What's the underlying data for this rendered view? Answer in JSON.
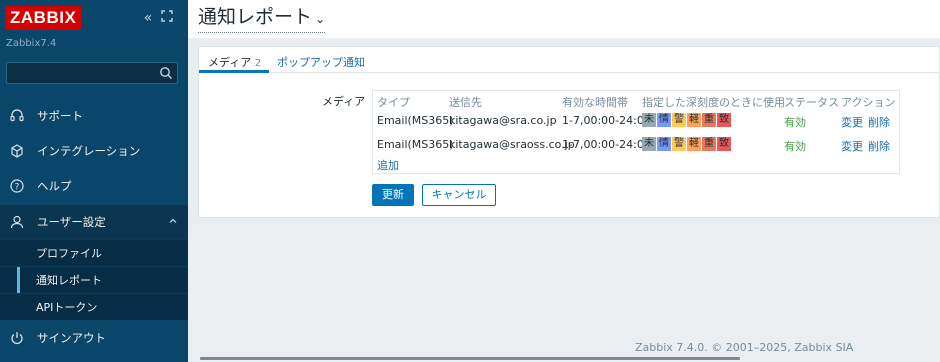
{
  "sidebar": {
    "logo": "ZABBIX",
    "version": "Zabbix7.4",
    "search_placeholder": "",
    "items": [
      {
        "label": "サポート",
        "icon": "headset-icon"
      },
      {
        "label": "インテグレーション",
        "icon": "cube-icon"
      },
      {
        "label": "ヘルプ",
        "icon": "help-icon"
      },
      {
        "label": "ユーザー設定",
        "icon": "user-icon"
      },
      {
        "label": "サインアウト",
        "icon": "power-icon"
      }
    ],
    "submenu": [
      {
        "label": "プロファイル"
      },
      {
        "label": "通知レポート"
      },
      {
        "label": "APIトークン"
      }
    ]
  },
  "page": {
    "title": "通知レポート"
  },
  "tabs": [
    {
      "label": "メディア",
      "badge": "2"
    },
    {
      "label": "ポップアップ通知"
    }
  ],
  "form": {
    "label": "メディア",
    "columns": [
      "タイプ",
      "送信先",
      "有効な時間帯",
      "指定した深刻度のときに使用",
      "ステータス",
      "アクション"
    ],
    "severity_labels": [
      "未",
      "情",
      "警",
      "軽",
      "重",
      "致"
    ],
    "severity_colors": [
      "#97aab3",
      "#7499ff",
      "#ffc859",
      "#ffa059",
      "#e97659",
      "#e45959"
    ],
    "rows": [
      {
        "type": "Email(MS365)",
        "sendto": "kitagawa@sra.co.jp",
        "period": "1-7,00:00-24:00",
        "status": "有効",
        "edit": "変更",
        "remove": "削除"
      },
      {
        "type": "Email(MS365)",
        "sendto": "kitagawa@sraoss.co.jp",
        "period": "1-7,00:00-24:00",
        "status": "有効",
        "edit": "変更",
        "remove": "削除"
      }
    ],
    "add_label": "追加",
    "update_button": "更新",
    "cancel_button": "キャンセル"
  },
  "footer": "Zabbix 7.4.0. © 2001–2025, Zabbix SIA"
}
